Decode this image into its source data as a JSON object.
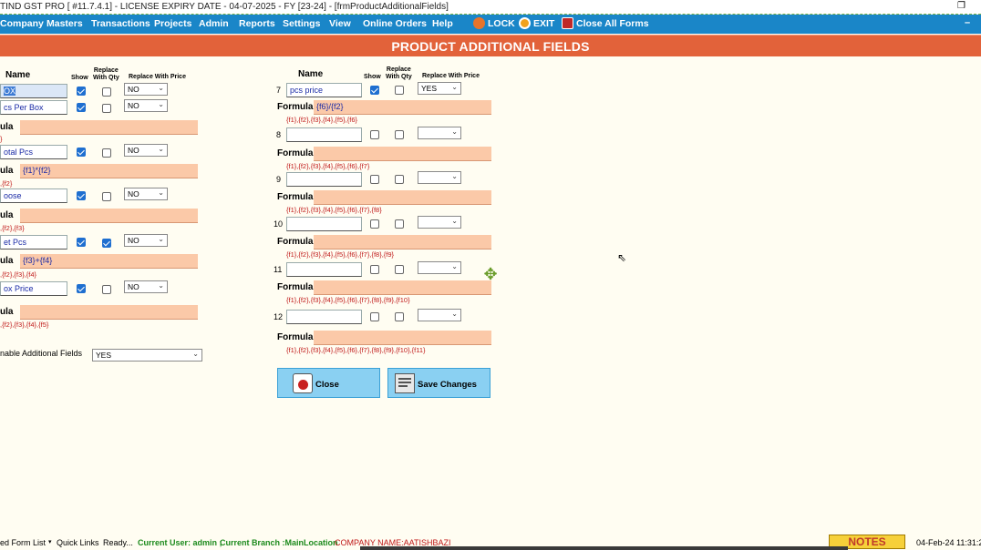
{
  "window": {
    "title": "TIND GST PRO [ #11.7.4.1] - LICENSE EXPIRY DATE - 04-07-2025 - FY [23-24] - [frmProductAdditionalFields]",
    "restore_glyph": "❐"
  },
  "menu": {
    "items": [
      "Company",
      "Masters",
      "Transactions",
      "Projects",
      "Admin",
      "Reports",
      "Settings",
      "View",
      "Online Orders",
      "Help"
    ],
    "lock": "LOCK",
    "exit": "EXIT",
    "close_all": "Close All Forms",
    "minimize": "–"
  },
  "header": {
    "title": "PRODUCT ADDITIONAL FIELDS"
  },
  "columns": {
    "name": "Name",
    "show": "Show",
    "replace_qty_1": "Replace",
    "replace_qty_2": "With Qty",
    "replace_price": "Replace With Price"
  },
  "formula_label": "Formula",
  "left_fields": [
    {
      "name": "OX",
      "show": true,
      "replace_qty": false,
      "price": "NO",
      "formula": "",
      "hint": ""
    },
    {
      "name": "cs Per Box",
      "show": true,
      "replace_qty": false,
      "price": "NO",
      "formula": "",
      "hint": "}"
    },
    {
      "name": "otal Pcs",
      "show": true,
      "replace_qty": false,
      "price": "NO",
      "formula": "{f1}*{f2}",
      "hint": ",{f2}"
    },
    {
      "name": "oose",
      "show": true,
      "replace_qty": false,
      "price": "NO",
      "formula": "",
      "hint": ",{f2},{f3}"
    },
    {
      "name": "et Pcs",
      "show": true,
      "replace_qty": true,
      "price": "NO",
      "formula": "{f3}+{f4}",
      "hint": ",{f2},{f3},{f4}"
    },
    {
      "name": "ox Price",
      "show": true,
      "replace_qty": false,
      "price": "NO",
      "formula": "",
      "hint": ",{f2},{f3},{f4},{f5}"
    }
  ],
  "formula_row_labels": [
    "ula",
    "ula",
    "ula",
    "ula",
    "ula"
  ],
  "enable": {
    "label": "nable Additional Fields",
    "value": "YES"
  },
  "right_fields": [
    {
      "num": "7",
      "name": "pcs price",
      "show": true,
      "replace_qty": false,
      "price": "YES",
      "formula": "{f6}/{f2}",
      "hint": "{f1},{f2},{f3},{f4},{f5},{f6}"
    },
    {
      "num": "8",
      "name": "",
      "show": false,
      "replace_qty": false,
      "price": "",
      "formula": "",
      "hint": "{f1},{f2},{f3},{f4},{f5},{f6},{f7}"
    },
    {
      "num": "9",
      "name": "",
      "show": false,
      "replace_qty": false,
      "price": "",
      "formula": "",
      "hint": "{f1},{f2},{f3},{f4},{f5},{f6},{f7},{f8}"
    },
    {
      "num": "10",
      "name": "",
      "show": false,
      "replace_qty": false,
      "price": "",
      "formula": "",
      "hint": "{f1},{f2},{f3},{f4},{f5},{f6},{f7},{f8},{f9}"
    },
    {
      "num": "11",
      "name": "",
      "show": false,
      "replace_qty": false,
      "price": "",
      "formula": "",
      "hint": "{f1},{f2},{f3},{f4},{f5},{f6},{f7},{f8},{f9},{f10}"
    },
    {
      "num": "12",
      "name": "",
      "show": false,
      "replace_qty": false,
      "price": "",
      "formula": "",
      "hint": "{f1},{f2},{f3},{f4},{f5},{f6},{f7},{f8},{f9},{f10},{f11}"
    }
  ],
  "buttons": {
    "close": "Close",
    "save": "Save Changes"
  },
  "status": {
    "form_list": "ed Form List",
    "quick_links": "Quick Links",
    "ready": "Ready...",
    "user": "Current User: admin ;",
    "branch": "Current Branch :MainLocation",
    "company": "COMPANY NAME:AATISHBAZI",
    "notes": "NOTES",
    "datetime": "04-Feb-24 11:31:2"
  },
  "colors": {
    "menu": "#1a86c8",
    "header": "#e2623a",
    "formula_bg": "#fbc9a8",
    "button": "#8ad0f2"
  }
}
